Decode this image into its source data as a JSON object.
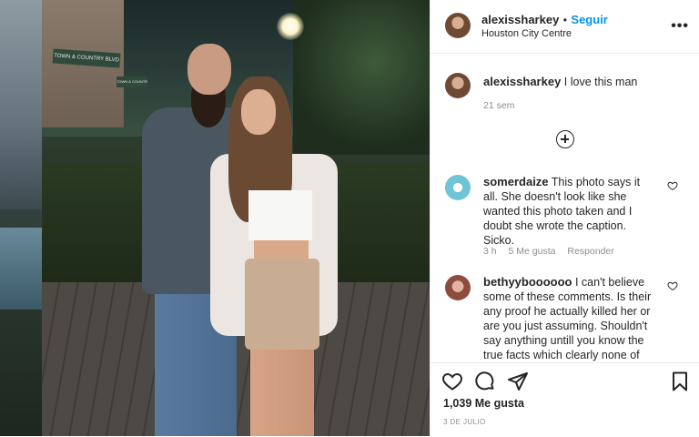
{
  "post": {
    "username": "alexissharkey",
    "separator": "•",
    "follow_label": "Seguir",
    "location": "Houston City Centre",
    "more_label": "•••",
    "caption": "I love this man",
    "caption_time": "21 sem"
  },
  "photo": {
    "street_sign_1": "TOWN & COUNTRY BLVD",
    "street_sign_2": "TOWN & COUNTRY"
  },
  "comments": [
    {
      "username": "somerdaize",
      "text": "This photo says it all. She doesn't look like she wanted this photo taken and I doubt she wrote the caption. Sicko.",
      "time": "3 h",
      "likes": "5 Me gusta",
      "reply": "Responder"
    },
    {
      "username": "bethyyboooooo",
      "text": "I can't believe some of these comments. Is their any proof he actually killed her or are you just assuming. Shouldn't say anything untill you know the true facts which clearly none of"
    }
  ],
  "actions": {
    "like_count": "1,039 Me gusta",
    "date": "3 DE JULIO"
  },
  "icons": [
    "heart-icon",
    "comment-icon",
    "share-icon",
    "bookmark-icon",
    "add-comments-icon",
    "more-icon"
  ],
  "colors": {
    "link_blue": "#0095f6",
    "text": "#262626",
    "muted": "#8e8e8e"
  }
}
